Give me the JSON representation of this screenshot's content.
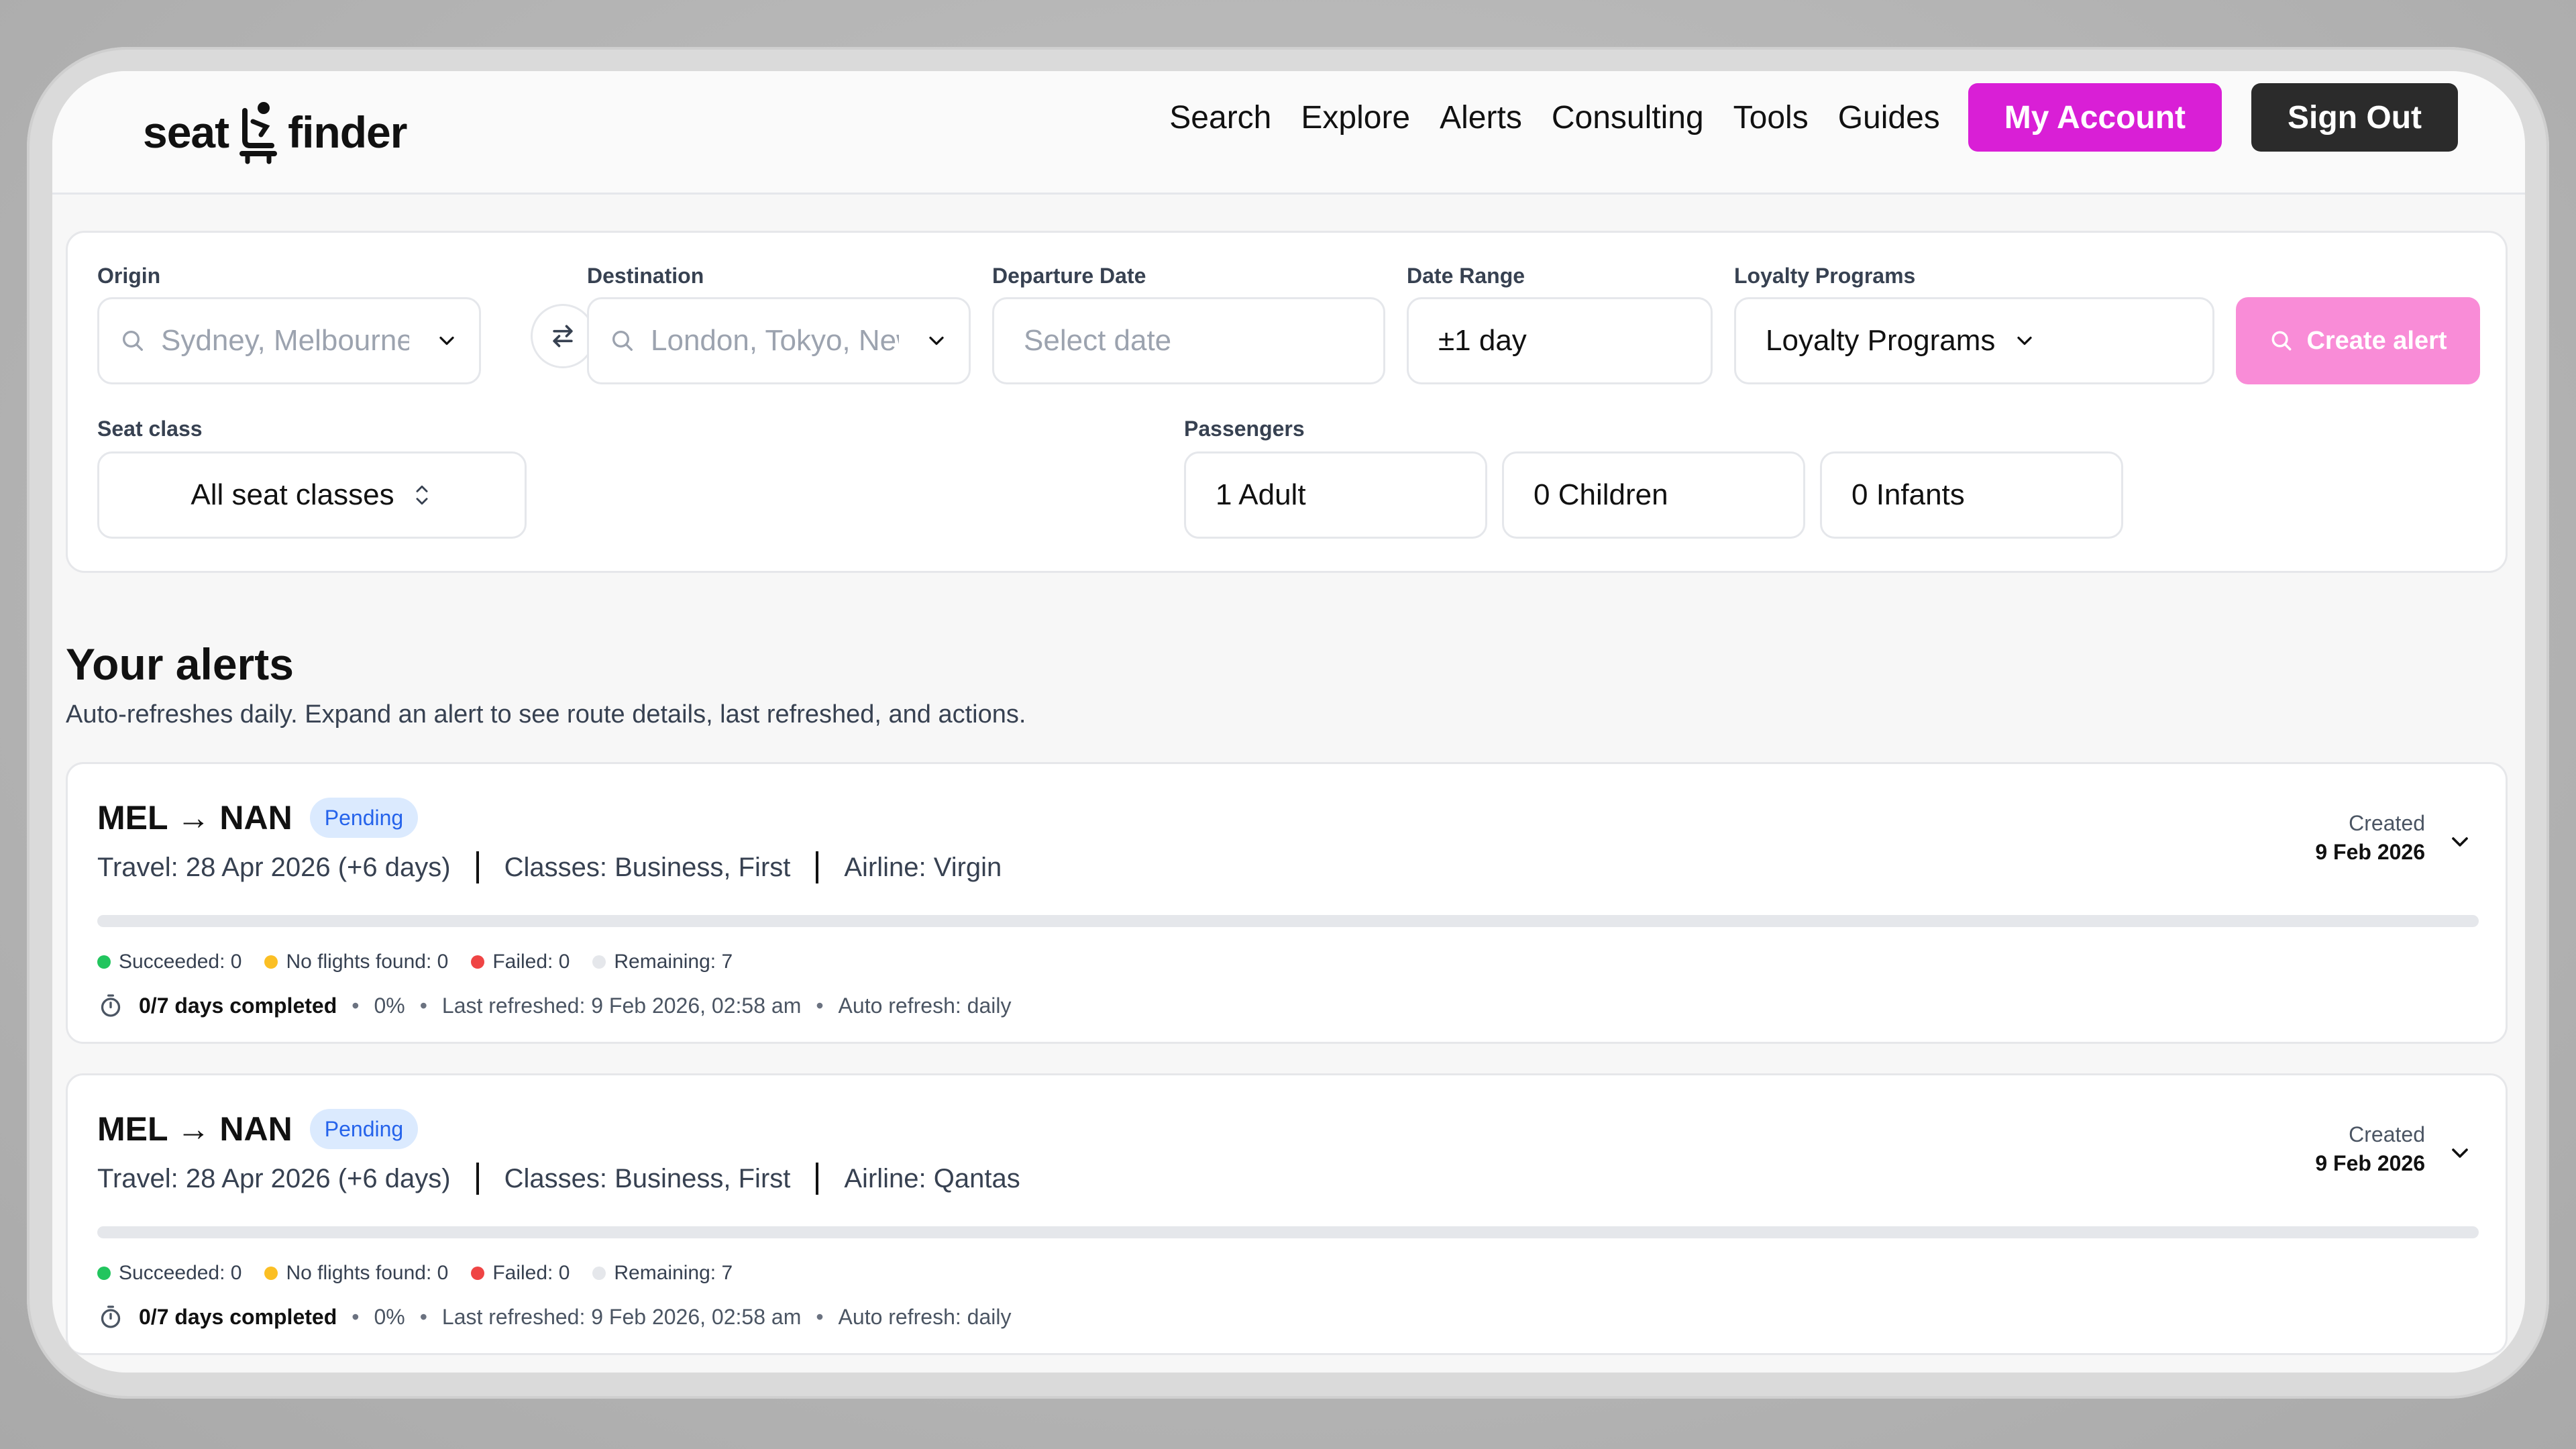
{
  "brand": {
    "left": "seat",
    "right": "finder"
  },
  "nav": {
    "links": [
      "Search",
      "Explore",
      "Alerts",
      "Consulting",
      "Tools",
      "Guides"
    ],
    "account_label": "My Account",
    "signout_label": "Sign Out"
  },
  "colors": {
    "accent": "#d91fd6",
    "create": "#f98cd7",
    "succeeded": "#22c55e",
    "no_flights": "#fbbf24",
    "failed": "#ef4444",
    "remaining": "#e5e7eb"
  },
  "search": {
    "origin": {
      "label": "Origin",
      "placeholder": "Sydney, Melbourne",
      "icon": "search-icon"
    },
    "destination": {
      "label": "Destination",
      "placeholder": "London, Tokyo, New York"
    },
    "departure": {
      "label": "Departure Date",
      "placeholder": "Select date"
    },
    "date_range": {
      "label": "Date Range",
      "value": "±1 day"
    },
    "loyalty": {
      "label": "Loyalty Programs",
      "value": "Loyalty Programs"
    },
    "create_label": "Create alert",
    "seat_class": {
      "label": "Seat class",
      "value": "All seat classes"
    },
    "passengers": {
      "label": "Passengers",
      "adults": "1 Adult",
      "children": "0 Children",
      "infants": "0 Infants"
    }
  },
  "alerts_section": {
    "title": "Your alerts",
    "subtitle": "Auto-refreshes daily. Expand an alert to see route details, last refreshed, and actions."
  },
  "alerts": [
    {
      "route": "MEL → NAN",
      "status": "Pending",
      "travel": "Travel: 28 Apr 2026 (+6 days)",
      "classes": "Classes: Business, First",
      "airline": "Airline: Virgin",
      "created_label": "Created",
      "created_date": "9 Feb 2026",
      "progress": 0,
      "succeeded": "Succeeded: 0",
      "no_flights": "No flights found: 0",
      "failed": "Failed: 0",
      "remaining": "Remaining: 7",
      "completed": "0/7 days completed",
      "percent": "0%",
      "last_refreshed": "Last refreshed: 9 Feb 2026, 02:58 am",
      "auto_refresh": "Auto refresh: daily"
    },
    {
      "route": "MEL → NAN",
      "status": "Pending",
      "travel": "Travel: 28 Apr 2026 (+6 days)",
      "classes": "Classes: Business, First",
      "airline": "Airline: Qantas",
      "created_label": "Created",
      "created_date": "9 Feb 2026",
      "progress": 0,
      "succeeded": "Succeeded: 0",
      "no_flights": "No flights found: 0",
      "failed": "Failed: 0",
      "remaining": "Remaining: 7",
      "completed": "0/7 days completed",
      "percent": "0%",
      "last_refreshed": "Last refreshed: 9 Feb 2026, 02:58 am",
      "auto_refresh": "Auto refresh: daily"
    }
  ]
}
